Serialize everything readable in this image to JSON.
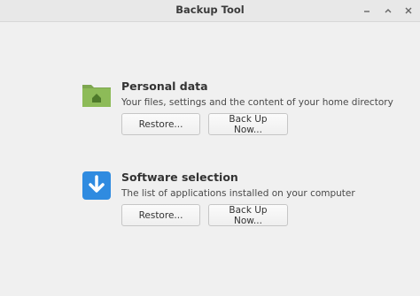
{
  "window": {
    "title": "Backup Tool",
    "controls": [
      "minimize-icon",
      "maximize-icon",
      "close-icon"
    ]
  },
  "sections": [
    {
      "icon": "folder-home-icon",
      "title": "Personal data",
      "description": "Your files, settings and the content of your home directory",
      "restore_label": "Restore...",
      "backup_label": "Back Up Now..."
    },
    {
      "icon": "download-arrow-icon",
      "title": "Software selection",
      "description": "The list of applications installed on your computer",
      "restore_label": "Restore...",
      "backup_label": "Back Up Now..."
    }
  ],
  "colors": {
    "folder": "#7ea650",
    "download_bg": "#2f8be0"
  }
}
